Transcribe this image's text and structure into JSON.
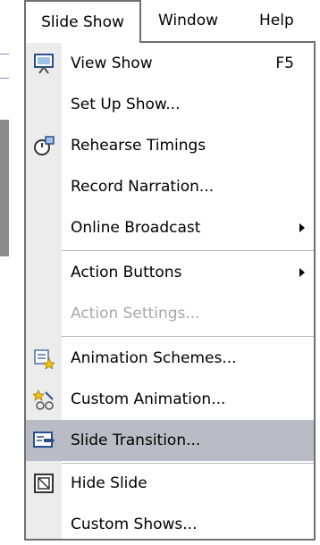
{
  "menubar": {
    "items": [
      {
        "label": "Slide Show"
      },
      {
        "label": "Window"
      },
      {
        "label": "Help"
      }
    ]
  },
  "menu": {
    "items": [
      {
        "label": "View Show",
        "shortcut": "F5",
        "icon": "view-show-icon"
      },
      {
        "label": "Set Up Show..."
      },
      {
        "label": "Rehearse Timings",
        "icon": "rehearse-timings-icon"
      },
      {
        "label": "Record Narration..."
      },
      {
        "label": "Online Broadcast",
        "submenu": true
      },
      {
        "label": "Action Buttons",
        "submenu": true
      },
      {
        "label": "Action Settings...",
        "disabled": true
      },
      {
        "label": "Animation Schemes...",
        "icon": "animation-schemes-icon"
      },
      {
        "label": "Custom Animation...",
        "icon": "custom-animation-icon"
      },
      {
        "label": "Slide Transition...",
        "icon": "slide-transition-icon",
        "highlighted": true
      },
      {
        "label": "Hide Slide",
        "icon": "hide-slide-icon"
      },
      {
        "label": "Custom Shows..."
      }
    ]
  },
  "colors": {
    "highlight": "#b9bcc4",
    "disabled_text": "#a8a8a8",
    "border": "#6f6f6f"
  }
}
